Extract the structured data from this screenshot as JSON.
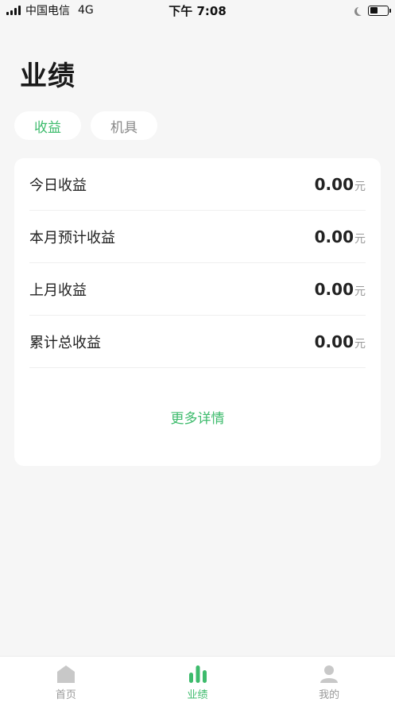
{
  "status_bar": {
    "carrier": "中国电信",
    "network": "4G",
    "time": "下午 7:08"
  },
  "page": {
    "title": "业绩"
  },
  "tabs": [
    {
      "label": "收益",
      "active": true
    },
    {
      "label": "机具",
      "active": false
    }
  ],
  "earnings": [
    {
      "label": "今日收益",
      "value": "0.00",
      "unit": "元"
    },
    {
      "label": "本月预计收益",
      "value": "0.00",
      "unit": "元"
    },
    {
      "label": "上月收益",
      "value": "0.00",
      "unit": "元"
    },
    {
      "label": "累计总收益",
      "value": "0.00",
      "unit": "元"
    }
  ],
  "more_link": "更多详情",
  "tabbar": [
    {
      "label": "首页",
      "icon": "home-icon",
      "active": false
    },
    {
      "label": "业绩",
      "icon": "bar-chart-icon",
      "active": true
    },
    {
      "label": "我的",
      "icon": "user-icon",
      "active": false
    }
  ],
  "colors": {
    "accent": "#3dbb6c",
    "inactive_icon": "#c8c8c8",
    "background": "#f6f6f6"
  }
}
